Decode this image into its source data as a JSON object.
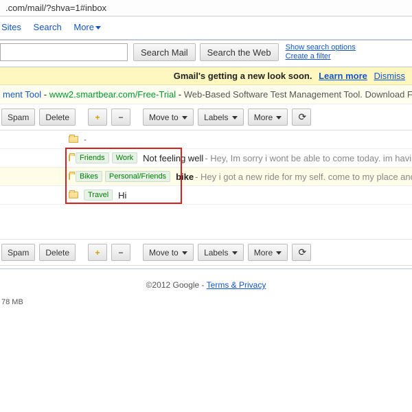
{
  "url": ".com/mail/?shva=1#inbox",
  "topnav": {
    "sites": "Sites",
    "search": "Search",
    "more": "More"
  },
  "searchbar": {
    "search_mail": "Search Mail",
    "search_web": "Search the Web",
    "show_opts": "Show search options",
    "create_filter": "Create a filter"
  },
  "banner": {
    "msg": "Gmail's getting a new look soon.",
    "learn": "Learn more",
    "dismiss": "Dismiss"
  },
  "ad": {
    "title": "ment Tool",
    "url": "www2.smartbear.com/Free-Trial",
    "desc": "Web-Based Software Test Management Tool. Download Free Trial."
  },
  "toolbar": {
    "spam": "Spam",
    "delete": "Delete",
    "moveto": "Move to",
    "labels": "Labels",
    "more": "More"
  },
  "header_dash": "-",
  "rows": [
    {
      "highlight": false,
      "labels": [
        "Friends",
        "Work"
      ],
      "subject": "Not feeling well",
      "subject_bold": false,
      "preview": "Hey, Im sorry i wont be able to come today. im having"
    },
    {
      "highlight": true,
      "labels": [
        "Bikes",
        "Personal/Friends"
      ],
      "subject": "bike",
      "subject_bold": true,
      "preview": "Hey i got a new ride for my self. come to my place and"
    },
    {
      "highlight": false,
      "labels": [
        "Travel"
      ],
      "subject": "Hi",
      "subject_bold": false,
      "preview": ""
    }
  ],
  "footer": {
    "copyright": "©2012 Google - ",
    "terms": "Terms & Privacy"
  },
  "storage": "78 MB"
}
